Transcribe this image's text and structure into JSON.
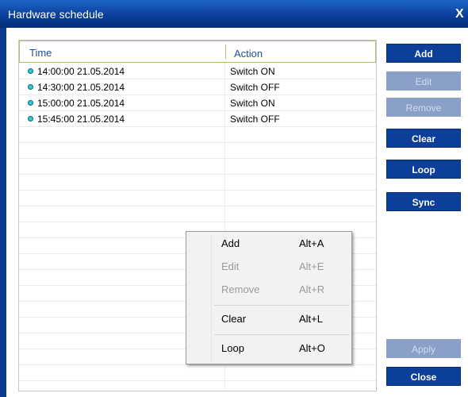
{
  "window": {
    "title": "Hardware schedule",
    "close_glyph": "X"
  },
  "list": {
    "columns": [
      "Time",
      "Action"
    ],
    "rows": [
      {
        "time": "14:00:00 21.05.2014",
        "action": "Switch ON"
      },
      {
        "time": "14:30:00 21.05.2014",
        "action": "Switch OFF"
      },
      {
        "time": "15:00:00 21.05.2014",
        "action": "Switch ON"
      },
      {
        "time": "15:45:00 21.05.2014",
        "action": "Switch OFF"
      }
    ]
  },
  "buttons": {
    "add": "Add",
    "edit": "Edit",
    "remove": "Remove",
    "clear": "Clear",
    "loop": "Loop",
    "sync": "Sync",
    "apply": "Apply",
    "close": "Close"
  },
  "context_menu": {
    "items": [
      {
        "label": "Add",
        "shortcut": "Alt+A"
      },
      {
        "label": "Edit",
        "shortcut": "Alt+E"
      },
      {
        "label": "Remove",
        "shortcut": "Alt+R"
      },
      {
        "label": "Clear",
        "shortcut": "Alt+L"
      },
      {
        "label": "Loop",
        "shortcut": "Alt+O"
      }
    ]
  },
  "colors": {
    "titlebar": "#0b3f9a",
    "button": "#0b3f9a",
    "button_disabled": "#8aa0c9",
    "status_dot": "#2ec8d8",
    "header_text": "#1d4f9a"
  }
}
